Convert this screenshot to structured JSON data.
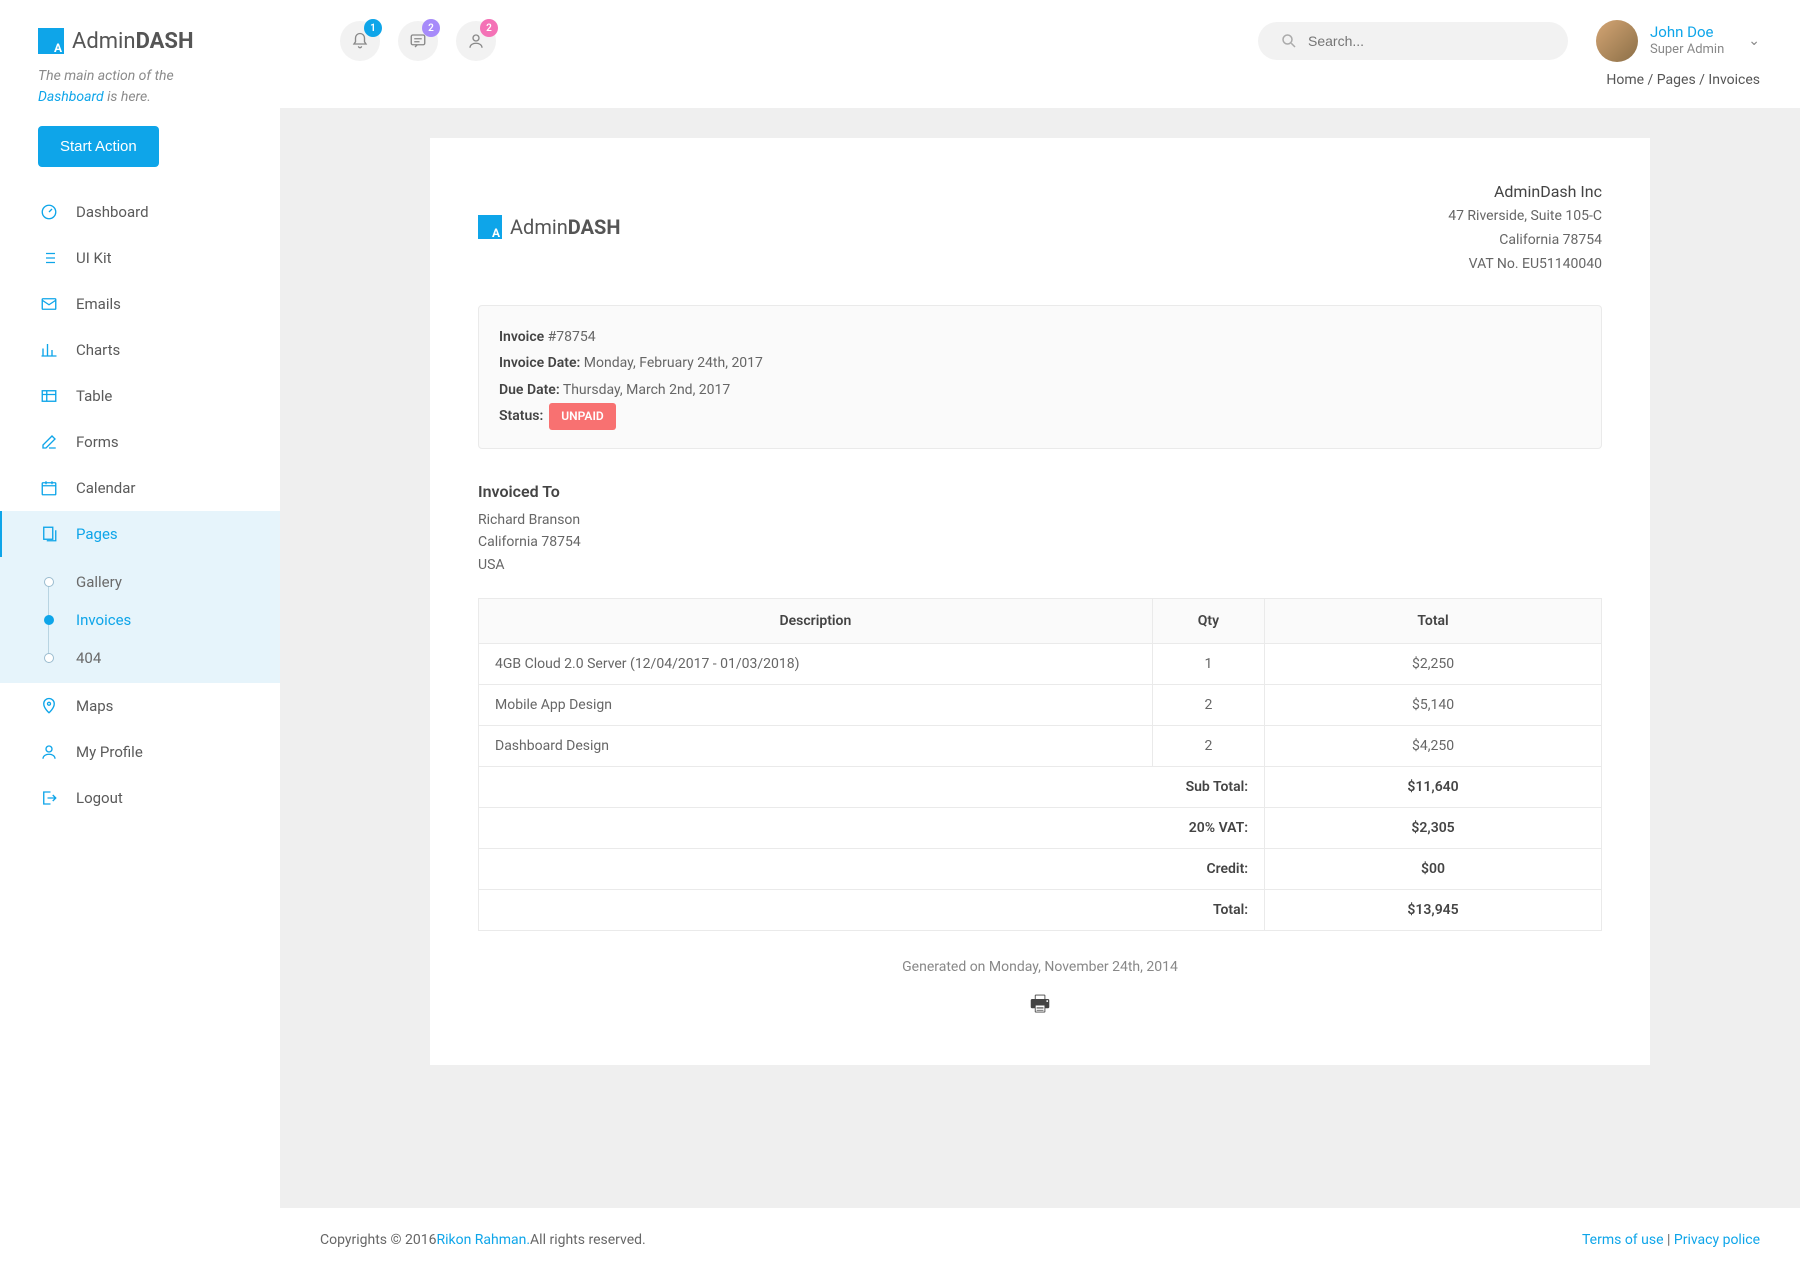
{
  "brand": {
    "prefix": "Admin",
    "suffix": "DASH"
  },
  "tagline": {
    "pre": "The main action of the ",
    "em": "Dashboard",
    "post": " is here."
  },
  "start_action": "Start Action",
  "nav": {
    "dashboard": "Dashboard",
    "uikit": "UI Kit",
    "emails": "Emails",
    "charts": "Charts",
    "table": "Table",
    "forms": "Forms",
    "calendar": "Calendar",
    "pages": "Pages",
    "maps": "Maps",
    "profile": "My Profile",
    "logout": "Logout",
    "sub": {
      "gallery": "Gallery",
      "invoices": "Invoices",
      "e404": "404"
    }
  },
  "topbar": {
    "badges": {
      "bell": "1",
      "chat": "2",
      "user": "2"
    },
    "search_placeholder": "Search...",
    "user": {
      "name": "John Doe",
      "role": "Super Admin"
    }
  },
  "breadcrumb": "Home / Pages / Invoices",
  "invoice": {
    "brand": {
      "prefix": "Admin",
      "suffix": "DASH"
    },
    "company": {
      "name": "AdminDash Inc",
      "addr1": "47 Riverside, Suite 105-C",
      "addr2": "California 78754",
      "vat": "VAT No. EU51140040"
    },
    "meta": {
      "invoice_label": "Invoice",
      "invoice_no": "#78754",
      "date_label": "Invoice Date:",
      "date_val": " Monday, February 24th, 2017",
      "due_label": "Due Date:",
      "due_val": " Thursday, March 2nd, 2017",
      "status_label": "Status:",
      "status_val": "UNPAID"
    },
    "billto": {
      "heading": "Invoiced To",
      "name": "Richard Branson",
      "addr": "California 78754",
      "country": "USA"
    },
    "columns": {
      "desc": "Description",
      "qty": "Qty",
      "total": "Total"
    },
    "rows": [
      {
        "desc": "4GB Cloud 2.0 Server (12/04/2017 - 01/03/2018)",
        "qty": "1",
        "total": "$2,250"
      },
      {
        "desc": "Mobile App Design",
        "qty": "2",
        "total": "$5,140"
      },
      {
        "desc": "Dashboard Design",
        "qty": "2",
        "total": "$4,250"
      }
    ],
    "summary": {
      "subtotal_label": "Sub Total:",
      "subtotal": "$11,640",
      "vat_label": "20% VAT:",
      "vat": "$2,305",
      "credit_label": "Credit:",
      "credit": "$00",
      "total_label": "Total:",
      "total": "$13,945"
    },
    "generated": "Generated on Monday, November 24th, 2014"
  },
  "footer": {
    "copy_pre": "Copyrights © 2016 ",
    "author": "Rikon Rahman.",
    "copy_post": " All rights reserved.",
    "terms": "Terms of use",
    "sep": " | ",
    "privacy": "Privacy police"
  }
}
